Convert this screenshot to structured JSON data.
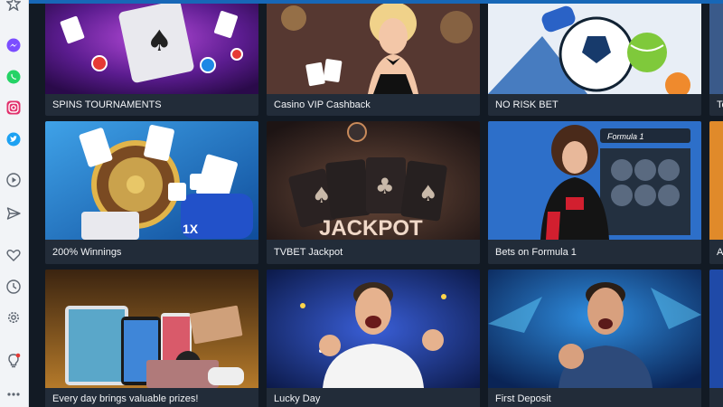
{
  "sidebar": {
    "icons": [
      {
        "name": "favorites-star-icon"
      },
      {
        "name": "messenger-icon"
      },
      {
        "name": "whatsapp-icon"
      },
      {
        "name": "instagram-icon"
      },
      {
        "name": "twitter-icon"
      },
      {
        "name": "play-icon"
      },
      {
        "name": "send-icon"
      },
      {
        "name": "heart-icon"
      },
      {
        "name": "clock-icon"
      },
      {
        "name": "settings-gear-icon"
      },
      {
        "name": "lightbulb-notification-icon"
      },
      {
        "name": "more-dots-icon"
      }
    ]
  },
  "cards": [
    {
      "label": "SPINS TOURNAMENTS"
    },
    {
      "label": "Casino VIP Cashback"
    },
    {
      "label": "NO RISK BET"
    },
    {
      "label": "To"
    },
    {
      "label": "200% Winnings"
    },
    {
      "label": "TVBET Jackpot"
    },
    {
      "label": "Bets on Formula 1"
    },
    {
      "label": "A"
    },
    {
      "label": "Every day brings valuable prizes!"
    },
    {
      "label": "Lucky Day"
    },
    {
      "label": "First Deposit"
    },
    {
      "label": ""
    }
  ],
  "promo_art": {
    "winnings_brand": "1X",
    "jackpot_word": "JACKPOT",
    "formula_banner": "Formula 1"
  },
  "colors": {
    "sidebar_bg": "#f2f4f7",
    "page_bg": "#121a24",
    "card_bg": "#222c39",
    "accent_blue": "#1767b7",
    "label_text": "#f2f4f7",
    "notification_dot": "#e53935"
  }
}
